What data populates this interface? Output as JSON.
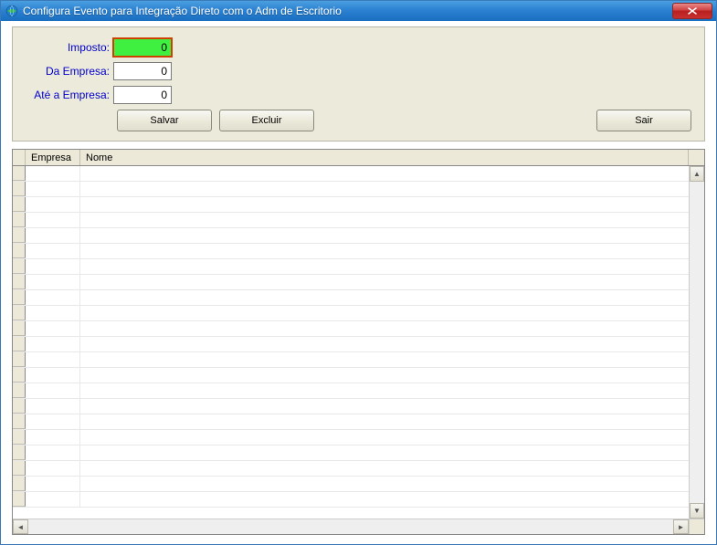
{
  "window": {
    "title": "Configura Evento para Integração Direto com o Adm de Escritorio"
  },
  "form": {
    "imposto": {
      "label": "Imposto:",
      "value": "0"
    },
    "da_empresa": {
      "label": "Da Empresa:",
      "value": "0"
    },
    "ate_empresa": {
      "label": "Até a Empresa:",
      "value": "0"
    }
  },
  "buttons": {
    "salvar": "Salvar",
    "excluir": "Excluir",
    "sair": "Sair"
  },
  "grid": {
    "headers": {
      "empresa": "Empresa",
      "nome": "Nome"
    },
    "rows": []
  }
}
